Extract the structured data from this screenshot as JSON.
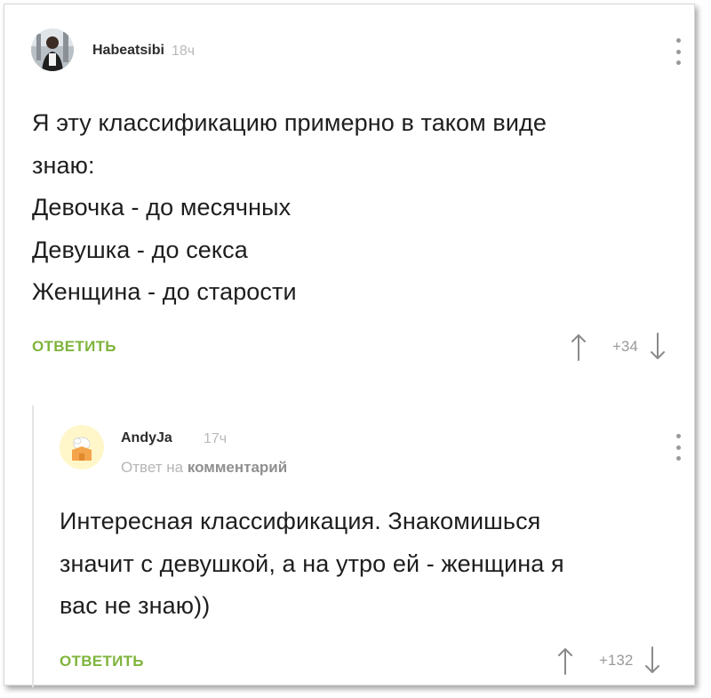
{
  "comment": {
    "author": "Habeatsibi",
    "time": "18ч",
    "text_lines": [
      "Я эту классификацию примерно в таком виде",
      "знаю:",
      "Девочка - до месячных",
      "Девушка - до секса",
      "Женщина - до старости"
    ],
    "reply_label": "ОТВЕТИТЬ",
    "score": "+34"
  },
  "reply": {
    "author": "AndyJa",
    "time": "17ч",
    "reply_to_prefix": "Ответ на",
    "reply_to_target": "комментарий",
    "text_lines": [
      "Интересная классификация. Знакомишься",
      "значит с девушкой, а на утро ей - женщина я",
      "вас не знаю))"
    ],
    "reply_label": "ОТВЕТИТЬ",
    "score": "+132"
  },
  "icons": {
    "menu": "more-vertical-icon",
    "upvote": "arrow-up-icon",
    "downvote": "arrow-down-icon"
  },
  "colors": {
    "accent": "#7fb43c",
    "muted": "#9a9a9a",
    "text": "#1e1e1e"
  }
}
